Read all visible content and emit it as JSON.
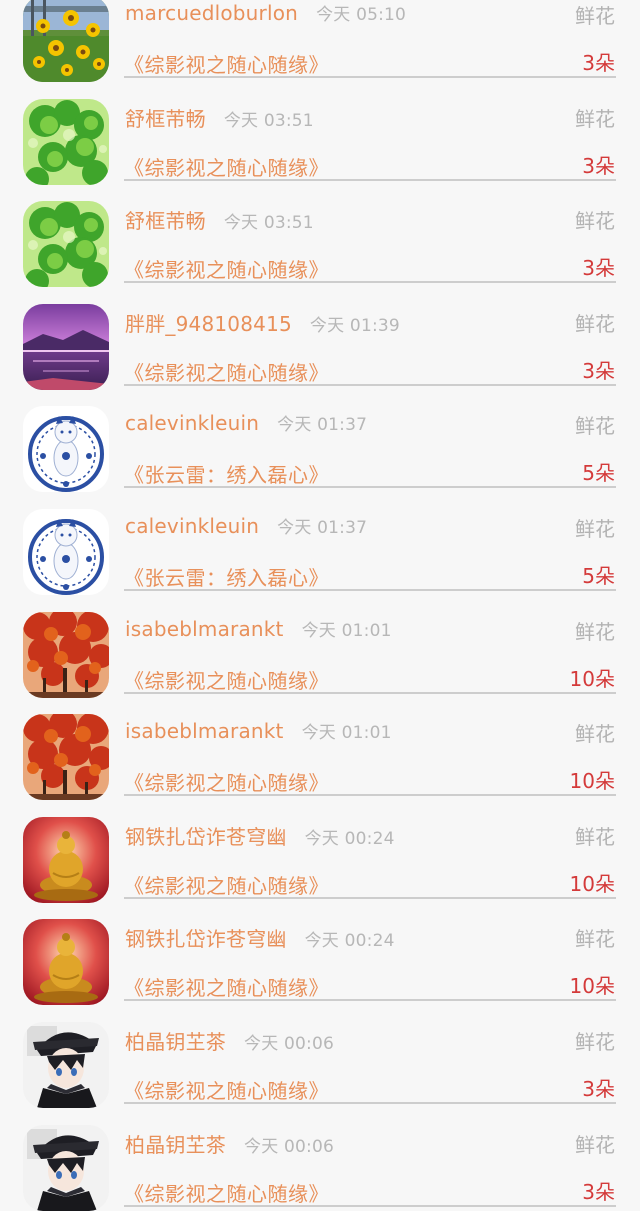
{
  "rows": [
    {
      "avatar": "flowers-avatar",
      "name": "marcuedloburlon",
      "time": "今天 05:10",
      "gift": "鲜花",
      "work": "《综影视之随心随缘》",
      "count": "3朵"
    },
    {
      "avatar": "clover-avatar",
      "name": "舒框芾畅",
      "time": "今天 03:51",
      "gift": "鲜花",
      "work": "《综影视之随心随缘》",
      "count": "3朵"
    },
    {
      "avatar": "clover-avatar",
      "name": "舒框芾畅",
      "time": "今天 03:51",
      "gift": "鲜花",
      "work": "《综影视之随心随缘》",
      "count": "3朵"
    },
    {
      "avatar": "sunset-lake-avatar",
      "name": "胖胖_948108415",
      "time": "今天 01:39",
      "gift": "鲜花",
      "work": "《综影视之随心随缘》",
      "count": "3朵"
    },
    {
      "avatar": "porcelain-cat-avatar",
      "name": "calevinkleuin",
      "time": "今天 01:37",
      "gift": "鲜花",
      "work": "《张云雷：绣入磊心》",
      "count": "5朵"
    },
    {
      "avatar": "porcelain-cat-avatar",
      "name": "calevinkleuin",
      "time": "今天 01:37",
      "gift": "鲜花",
      "work": "《张云雷：绣入磊心》",
      "count": "5朵"
    },
    {
      "avatar": "autumn-tree-avatar",
      "name": "isabeblmarankt",
      "time": "今天 01:01",
      "gift": "鲜花",
      "work": "《综影视之随心随缘》",
      "count": "10朵"
    },
    {
      "avatar": "autumn-tree-avatar",
      "name": "isabeblmarankt",
      "time": "今天 01:01",
      "gift": "鲜花",
      "work": "《综影视之随心随缘》",
      "count": "10朵"
    },
    {
      "avatar": "golden-buddha-avatar",
      "name": "钢铁扎岱诈苍穹幽",
      "time": "今天 00:24",
      "gift": "鲜花",
      "work": "《综影视之随心随缘》",
      "count": "10朵"
    },
    {
      "avatar": "golden-buddha-avatar",
      "name": "钢铁扎岱诈苍穹幽",
      "time": "今天 00:24",
      "gift": "鲜花",
      "work": "《综影视之随心随缘》",
      "count": "10朵"
    },
    {
      "avatar": "anime-boy-avatar",
      "name": "柏晶钥芏茶",
      "time": "今天 00:06",
      "gift": "鲜花",
      "work": "《综影视之随心随缘》",
      "count": "3朵"
    },
    {
      "avatar": "anime-boy-avatar",
      "name": "柏晶钥芏茶",
      "time": "今天 00:06",
      "gift": "鲜花",
      "work": "《综影视之随心随缘》",
      "count": "3朵"
    }
  ]
}
